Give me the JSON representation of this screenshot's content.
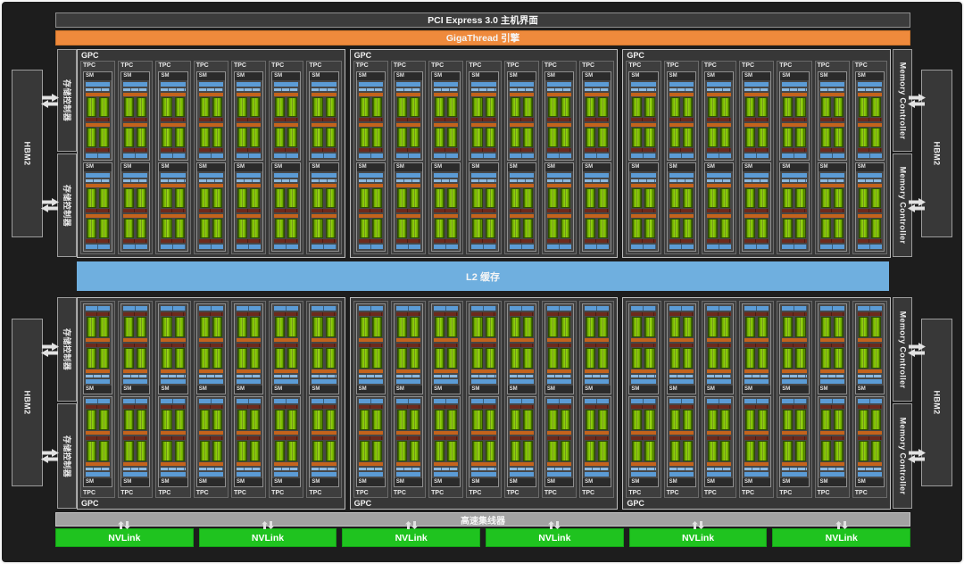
{
  "bars": {
    "pci": "PCI Express 3.0 主机界面",
    "gigathread": "GigaThread 引擎",
    "l2": "L2 缓存",
    "hub": "高速集线器"
  },
  "labels": {
    "gpc": "GPC",
    "tpc": "TPC",
    "sm": "SM",
    "hbm2": "HBM2",
    "memory_controller_left": "存储控制器",
    "memory_controller_right": "Memory Controller",
    "nvlink": "NVLink"
  },
  "counts": {
    "gpc_count": 6,
    "tpcs_per_gpc": 7,
    "sms_per_tpc": 2,
    "compute_rows_per_sm": 2,
    "core_columns_per_row": 2,
    "nvlink_count": 6,
    "memory_controllers_per_side": 4,
    "hbm2_stacks_per_side": 2
  },
  "icons": {
    "horizontal": "bidirectional-left-right-arrow-icon",
    "vertical": "bidirectional-up-down-arrow-icon"
  },
  "colors": {
    "canvas_bg": "#1d1d1d",
    "bar_bg": "#3c3c3c",
    "bar_border": "#8f8f8f",
    "gigathread_orange": "#ef8a3c",
    "l2_blue": "#6fafdf",
    "hub_gray": "#a2a2a2",
    "nvlink_green": "#1fc31f",
    "box_bg": "#383838",
    "box_border": "#9c9c9c",
    "gpc_bg": "#373737",
    "gpc_border": "#bdbdbd",
    "tpc_bg": "#3e3e3e",
    "tpc_border": "#6a6a6a",
    "sm_bg": "#474747",
    "sm_border": "#8f8f8f",
    "sm_label_bg": "#2b2b2b",
    "blue_bar": "#5b9bd5",
    "blue_thin": "#8cb9df",
    "orange_bar": "#c4631c",
    "maroon_bar": "#6d2a1d",
    "core_dark": "#558a00",
    "core_mid": "#7fc200",
    "core_light": "#a4d62a",
    "arrow_color": "#e2e2e2"
  }
}
